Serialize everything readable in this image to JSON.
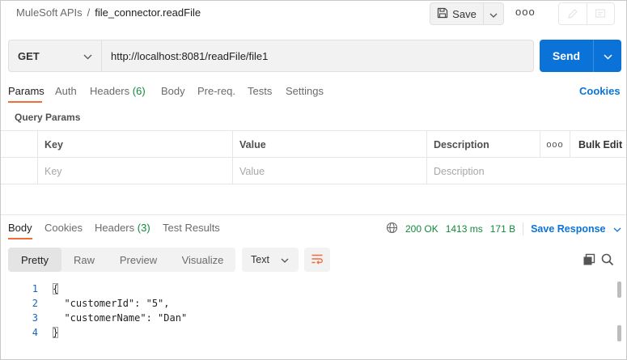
{
  "breadcrumb": {
    "collection": "MuleSoft APIs",
    "separator": "/",
    "request": "file_connector.readFile"
  },
  "toolbar": {
    "save_label": "Save",
    "more_label": "ooo"
  },
  "request": {
    "method": "GET",
    "url": "http://localhost:8081/readFile/file1",
    "send_label": "Send"
  },
  "request_tabs": {
    "items": [
      {
        "label": "Params"
      },
      {
        "label": "Auth"
      },
      {
        "label": "Headers",
        "count": "(6)"
      },
      {
        "label": "Body"
      },
      {
        "label": "Pre-req."
      },
      {
        "label": "Tests"
      },
      {
        "label": "Settings"
      }
    ],
    "cookies_label": "Cookies"
  },
  "params": {
    "section_title": "Query Params",
    "headers": {
      "key": "Key",
      "value": "Value",
      "description": "Description",
      "more": "ooo",
      "bulk_edit": "Bulk Edit"
    },
    "placeholders": {
      "key": "Key",
      "value": "Value",
      "description": "Description"
    }
  },
  "response_tabs": {
    "items": [
      {
        "label": "Body"
      },
      {
        "label": "Cookies"
      },
      {
        "label": "Headers",
        "count": "(3)"
      },
      {
        "label": "Test Results"
      }
    ]
  },
  "response_status": {
    "status": "200 OK",
    "time": "1413 ms",
    "size": "171 B",
    "save_response_label": "Save Response"
  },
  "body_view": {
    "modes": [
      "Pretty",
      "Raw",
      "Preview",
      "Visualize"
    ],
    "format": "Text"
  },
  "code": {
    "lines": [
      {
        "n": "1",
        "text": "{"
      },
      {
        "n": "2",
        "text": "  \"customerId\": \"5\","
      },
      {
        "n": "3",
        "text": "  \"customerName\": \"Dan\""
      },
      {
        "n": "4",
        "text": "}"
      }
    ]
  },
  "colors": {
    "accent": "#0b73d8",
    "tab_underline": "#f26b3a",
    "success": "#0f8a3a"
  }
}
